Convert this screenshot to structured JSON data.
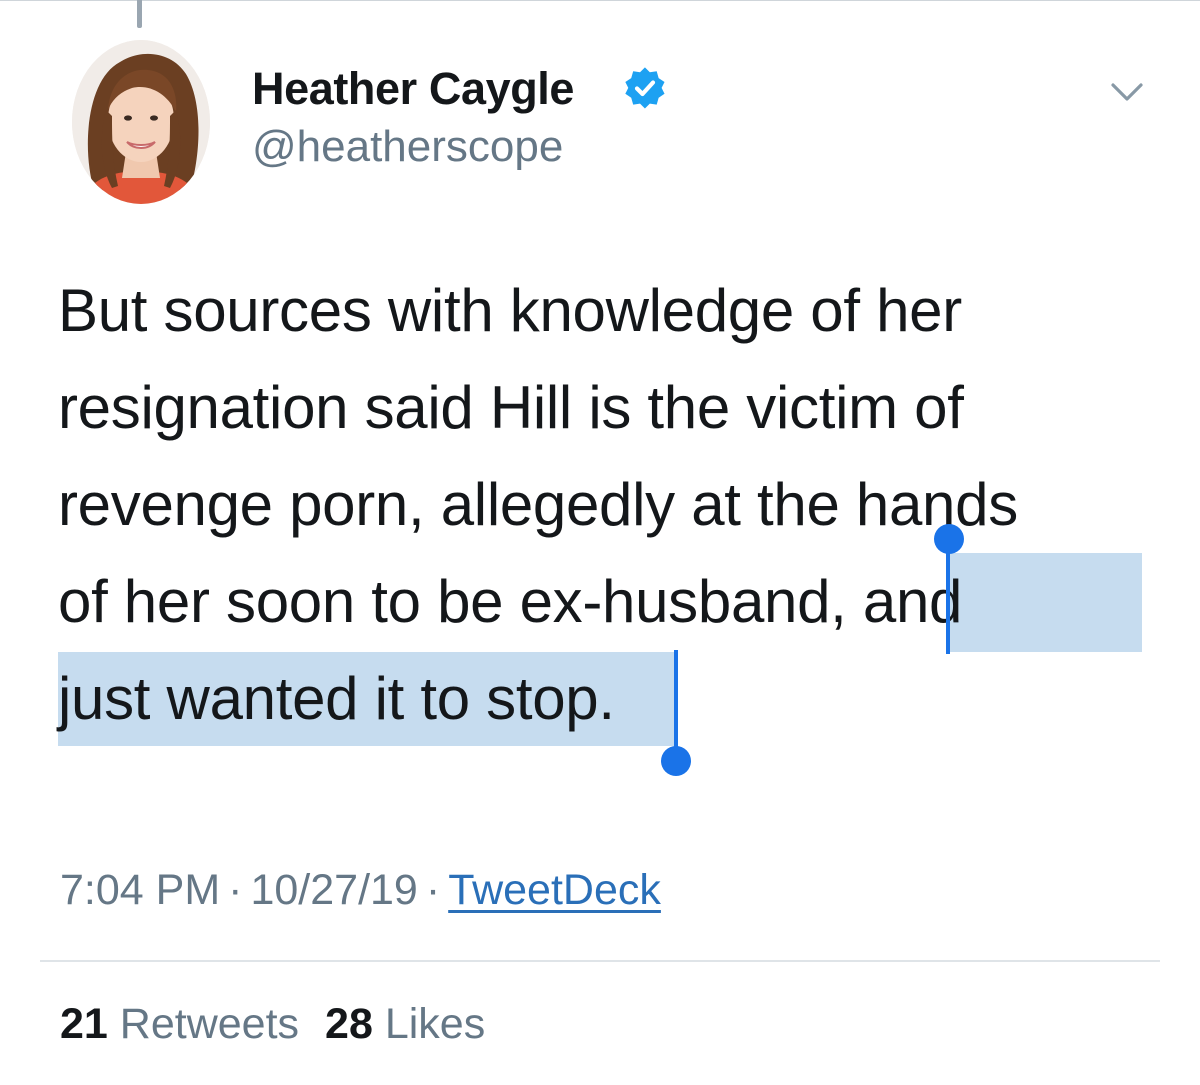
{
  "author": {
    "name": "Heather Caygle",
    "handle": "@heatherscope",
    "verified": true
  },
  "tweet": {
    "lines": [
      "But sources with knowledge of her",
      "resignation said Hill is the victim of",
      "revenge porn, allegedly at the hands",
      "of her soon to be ex-husband, and",
      "just wanted it to stop."
    ],
    "selected_text": "and just wanted it to stop."
  },
  "meta": {
    "time": "7:04 PM",
    "date": "10/27/19",
    "separator": "·",
    "source": "TweetDeck"
  },
  "stats": {
    "retweets_count": "21",
    "retweets_label": "Retweets",
    "likes_count": "28",
    "likes_label": "Likes"
  },
  "icons": {
    "verified": "verified-badge-icon",
    "caret": "chevron-down-icon"
  },
  "colors": {
    "text": "#14171a",
    "secondary": "#657786",
    "verified": "#1da1f2",
    "selection": "#c6dcef",
    "selection_handle": "#1a73e8",
    "link": "#2a6fb8"
  }
}
